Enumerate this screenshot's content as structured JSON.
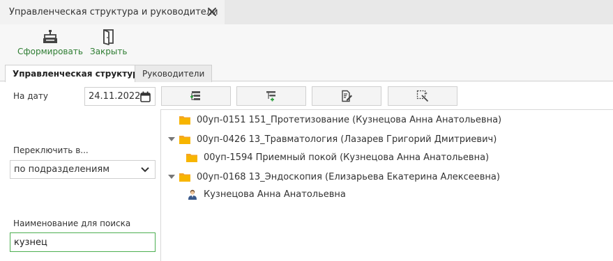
{
  "window": {
    "title": "Управленческая структура и руководители",
    "close_icon": "close-icon"
  },
  "toolbar": {
    "form_label": "Сформировать",
    "close_label": "Закрыть"
  },
  "tabs": [
    {
      "label": "Управленческая структура",
      "active": true
    },
    {
      "label": "Руководители",
      "active": false
    }
  ],
  "filters": {
    "date_label": "На дату",
    "date_value": "24.11.2022",
    "switch_label": "Переключить в...",
    "switch_value": "по подразделениям",
    "search_label": "Наименование для поиска",
    "search_value": "кузнец"
  },
  "action_buttons": [
    "add-node-icon",
    "add-child-icon",
    "edit-icon",
    "select-icon"
  ],
  "tree": [
    {
      "text": "00уп-0151 151_Протетизование (Кузнецова Анна Анатольевна)",
      "type": "folder",
      "expanded": false
    },
    {
      "text": "00уп-0426 13_Травматология (Лазарев Григорий Дмитриевич)",
      "type": "folder",
      "expanded": true
    },
    {
      "text": "00уп-1594 Приемный покой (Кузнецова Анна Анатольевна)",
      "type": "folder",
      "expanded": false
    },
    {
      "text": "00уп-0168 13_Эндоскопия (Елизарьева Екатерина Алексеевна)",
      "type": "folder",
      "expanded": true
    },
    {
      "text": "Кузнецова Анна Анатольевна",
      "type": "person",
      "expanded": false
    }
  ],
  "colors": {
    "accent_green": "#2e7d32",
    "folder_orange": "#f5a623",
    "search_border": "#4caf50"
  }
}
